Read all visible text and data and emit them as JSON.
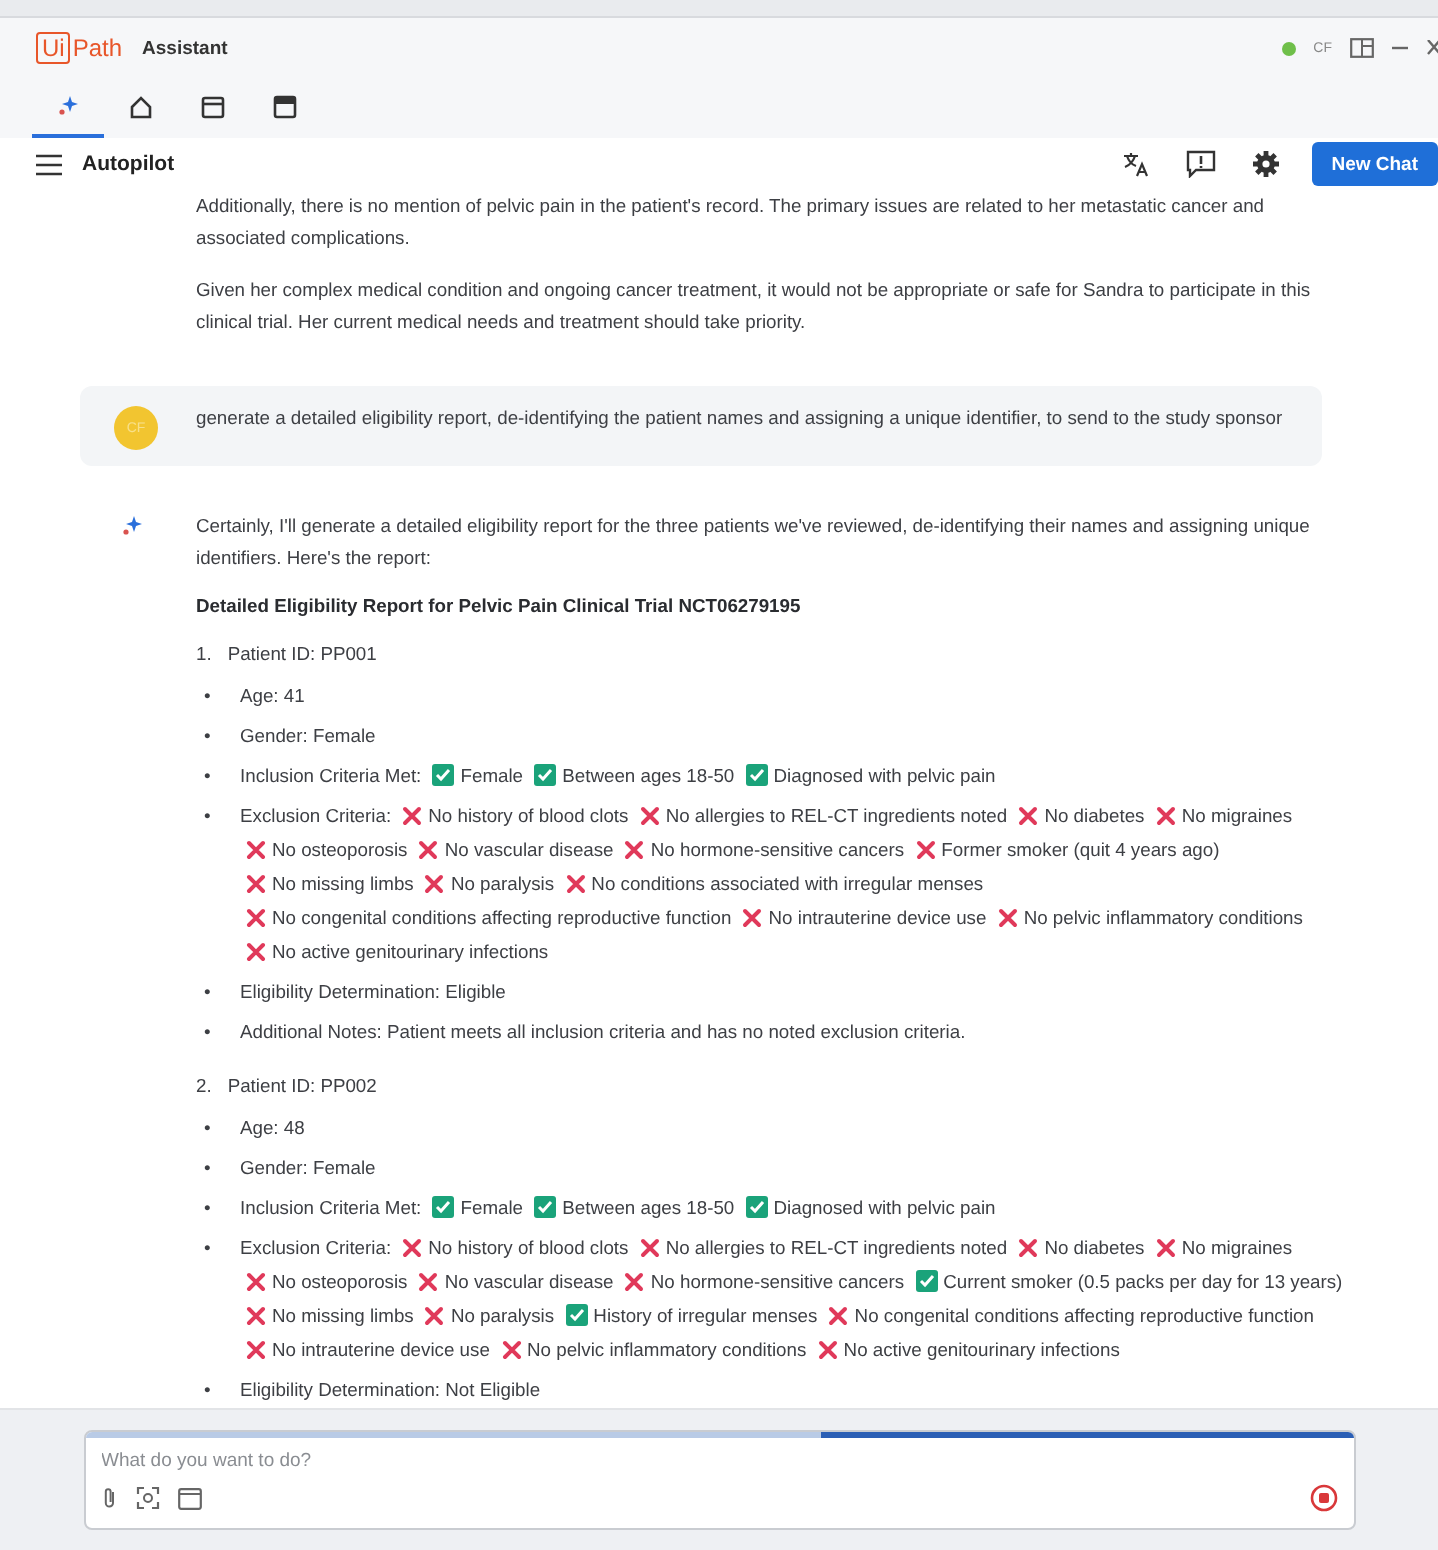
{
  "window": {
    "logo_box": "Ui",
    "logo_text": "Path",
    "title": "Assistant",
    "user_initials": "CF",
    "online": true
  },
  "tabs": [
    {
      "kind": "autopilot",
      "selected": true
    },
    {
      "kind": "home",
      "selected": false
    },
    {
      "kind": "calendar",
      "selected": false
    },
    {
      "kind": "store",
      "selected": false
    }
  ],
  "header": {
    "title": "Autopilot",
    "new_chat": "New Chat"
  },
  "conversation": [
    {
      "kind": "assistant_continued",
      "paragraphs": [
        "Additionally, there is no mention of pelvic pain in the patient's record. The primary issues are related to her metastatic cancer and associated complications.",
        "Given her complex medical condition and ongoing cancer treatment, it would not be appropriate or safe for Sandra to participate in this clinical trial. Her current medical needs and treatment should take priority."
      ]
    },
    {
      "kind": "user",
      "avatar": "CF",
      "text": "generate a detailed eligibility report, de-identifying the patient names and assigning a unique identifier, to send to the study sponsor"
    },
    {
      "kind": "assistant",
      "paragraphs": [
        "Certainly, I'll generate a detailed eligibility report for the three patients we've reviewed, de-identifying their names and assigning unique identifiers. Here's the report:"
      ],
      "report": {
        "title": "Detailed Eligibility Report for Pelvic Pain Clinical Trial NCT06279195",
        "patients": [
          {
            "number": "1.",
            "heading": "Patient ID: PP001",
            "fields": [
              {
                "kind": "text",
                "bullet": "•",
                "text": "Age: 41"
              },
              {
                "kind": "text",
                "bullet": "•",
                "text": "Gender: Female"
              },
              {
                "kind": "criteria",
                "bullet": "•",
                "label": "Inclusion Criteria Met:",
                "items": [
                  {
                    "met": true,
                    "text": "Female"
                  },
                  {
                    "met": true,
                    "text": "Between ages 18-50"
                  },
                  {
                    "met": true,
                    "text": "Diagnosed with pelvic pain"
                  }
                ]
              },
              {
                "kind": "criteria",
                "bullet": "•",
                "label": "Exclusion Criteria:",
                "items": [
                  {
                    "met": false,
                    "text": "No history of blood clots"
                  },
                  {
                    "met": false,
                    "text": "No allergies to REL-CT ingredients noted"
                  },
                  {
                    "met": false,
                    "text": "No diabetes"
                  },
                  {
                    "met": false,
                    "text": "No migraines"
                  },
                  {
                    "met": false,
                    "text": "No osteoporosis"
                  },
                  {
                    "met": false,
                    "text": "No vascular disease"
                  },
                  {
                    "met": false,
                    "text": "No hormone-sensitive cancers"
                  },
                  {
                    "met": false,
                    "text": "Former smoker (quit 4 years ago)"
                  },
                  {
                    "met": false,
                    "text": "No missing limbs"
                  },
                  {
                    "met": false,
                    "text": "No paralysis"
                  },
                  {
                    "met": false,
                    "text": "No conditions associated with irregular menses"
                  },
                  {
                    "met": false,
                    "text": "No congenital conditions affecting reproductive function"
                  },
                  {
                    "met": false,
                    "text": "No intrauterine device use"
                  },
                  {
                    "met": false,
                    "text": "No pelvic inflammatory conditions"
                  },
                  {
                    "met": false,
                    "text": "No active genitourinary infections"
                  }
                ]
              },
              {
                "kind": "text",
                "bullet": "•",
                "text": "Eligibility Determination: Eligible"
              },
              {
                "kind": "text",
                "bullet": "•",
                "text": "Additional Notes: Patient meets all inclusion criteria and has no noted exclusion criteria."
              }
            ]
          },
          {
            "number": "2.",
            "heading": "Patient ID: PP002",
            "fields": [
              {
                "kind": "text",
                "bullet": "•",
                "text": "Age: 48"
              },
              {
                "kind": "text",
                "bullet": "•",
                "text": "Gender: Female"
              },
              {
                "kind": "criteria",
                "bullet": "•",
                "label": "Inclusion Criteria Met:",
                "items": [
                  {
                    "met": true,
                    "text": "Female"
                  },
                  {
                    "met": true,
                    "text": "Between ages 18-50"
                  },
                  {
                    "met": true,
                    "text": "Diagnosed with pelvic pain"
                  }
                ]
              },
              {
                "kind": "criteria",
                "bullet": "•",
                "label": "Exclusion Criteria:",
                "items": [
                  {
                    "met": false,
                    "text": "No history of blood clots"
                  },
                  {
                    "met": false,
                    "text": "No allergies to REL-CT ingredients noted"
                  },
                  {
                    "met": false,
                    "text": "No diabetes"
                  },
                  {
                    "met": false,
                    "text": "No migraines"
                  },
                  {
                    "met": false,
                    "text": "No osteoporosis"
                  },
                  {
                    "met": false,
                    "text": "No vascular disease"
                  },
                  {
                    "met": false,
                    "text": "No hormone-sensitive cancers"
                  },
                  {
                    "met": true,
                    "text": "Current smoker (0.5 packs per day for 13 years)"
                  },
                  {
                    "met": false,
                    "text": "No missing limbs"
                  },
                  {
                    "met": false,
                    "text": "No paralysis"
                  },
                  {
                    "met": true,
                    "text": "History of irregular menses"
                  },
                  {
                    "met": false,
                    "text": "No congenital conditions affecting reproductive function"
                  },
                  {
                    "met": false,
                    "text": "No intrauterine device use"
                  },
                  {
                    "met": false,
                    "text": "No pelvic inflammatory conditions"
                  },
                  {
                    "met": false,
                    "text": "No active genitourinary infections"
                  }
                ]
              },
              {
                "kind": "text",
                "bullet": "•",
                "text": "Eligibility Determination: Not Eligible"
              }
            ]
          }
        ]
      }
    }
  ],
  "composer": {
    "placeholder": "What do you want to do?"
  }
}
